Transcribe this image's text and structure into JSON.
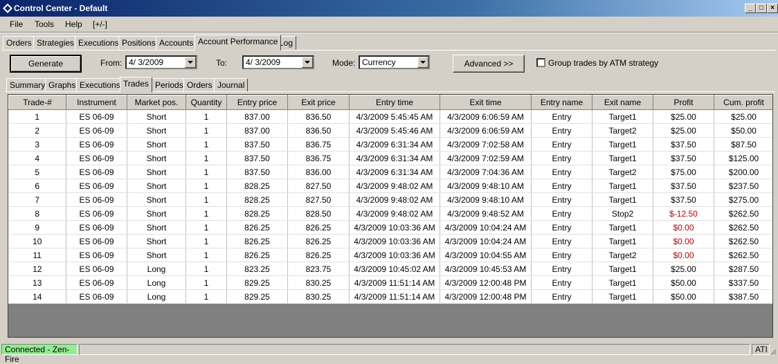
{
  "window": {
    "title": "Control Center - Default"
  },
  "menu": [
    "File",
    "Tools",
    "Help",
    "[+/-]"
  ],
  "main_tabs": [
    "Orders",
    "Strategies",
    "Executions",
    "Positions",
    "Accounts",
    "Account Performance",
    "Log"
  ],
  "toolbar": {
    "generate_label": "Generate",
    "from_label": "From:",
    "from_value": "4/  3/2009",
    "to_label": "To:",
    "to_value": "4/  3/2009",
    "mode_label": "Mode:",
    "mode_value": "Currency",
    "advanced_label": "Advanced >>",
    "group_label": "Group trades by ATM strategy"
  },
  "sub_tabs": [
    "Summary",
    "Graphs",
    "Executions",
    "Trades",
    "Periods",
    "Orders",
    "Journal"
  ],
  "table": {
    "headers": [
      "Trade-#",
      "Instrument",
      "Market pos.",
      "Quantity",
      "Entry price",
      "Exit price",
      "Entry time",
      "Exit time",
      "Entry name",
      "Exit name",
      "Profit",
      "Cum. profit"
    ],
    "rows": [
      [
        "1",
        "ES 06-09",
        "Short",
        "1",
        "837.00",
        "836.50",
        "4/3/2009 5:45:45 AM",
        "4/3/2009 6:06:59 AM",
        "Entry",
        "Target1",
        "$25.00",
        "$25.00"
      ],
      [
        "2",
        "ES 06-09",
        "Short",
        "1",
        "837.00",
        "836.50",
        "4/3/2009 5:45:46 AM",
        "4/3/2009 6:06:59 AM",
        "Entry",
        "Target2",
        "$25.00",
        "$50.00"
      ],
      [
        "3",
        "ES 06-09",
        "Short",
        "1",
        "837.50",
        "836.75",
        "4/3/2009 6:31:34 AM",
        "4/3/2009 7:02:58 AM",
        "Entry",
        "Target1",
        "$37.50",
        "$87.50"
      ],
      [
        "4",
        "ES 06-09",
        "Short",
        "1",
        "837.50",
        "836.75",
        "4/3/2009 6:31:34 AM",
        "4/3/2009 7:02:59 AM",
        "Entry",
        "Target1",
        "$37.50",
        "$125.00"
      ],
      [
        "5",
        "ES 06-09",
        "Short",
        "1",
        "837.50",
        "836.00",
        "4/3/2009 6:31:34 AM",
        "4/3/2009 7:04:36 AM",
        "Entry",
        "Target2",
        "$75.00",
        "$200.00"
      ],
      [
        "6",
        "ES 06-09",
        "Short",
        "1",
        "828.25",
        "827.50",
        "4/3/2009 9:48:02 AM",
        "4/3/2009 9:48:10 AM",
        "Entry",
        "Target1",
        "$37.50",
        "$237.50"
      ],
      [
        "7",
        "ES 06-09",
        "Short",
        "1",
        "828.25",
        "827.50",
        "4/3/2009 9:48:02 AM",
        "4/3/2009 9:48:10 AM",
        "Entry",
        "Target1",
        "$37.50",
        "$275.00"
      ],
      [
        "8",
        "ES 06-09",
        "Short",
        "1",
        "828.25",
        "828.50",
        "4/3/2009 9:48:02 AM",
        "4/3/2009 9:48:52 AM",
        "Entry",
        "Stop2",
        "$-12.50",
        "$262.50"
      ],
      [
        "9",
        "ES 06-09",
        "Short",
        "1",
        "826.25",
        "826.25",
        "4/3/2009 10:03:36 AM",
        "4/3/2009 10:04:24 AM",
        "Entry",
        "Target1",
        "$0.00",
        "$262.50"
      ],
      [
        "10",
        "ES 06-09",
        "Short",
        "1",
        "826.25",
        "826.25",
        "4/3/2009 10:03:36 AM",
        "4/3/2009 10:04:24 AM",
        "Entry",
        "Target1",
        "$0.00",
        "$262.50"
      ],
      [
        "11",
        "ES 06-09",
        "Short",
        "1",
        "826.25",
        "826.25",
        "4/3/2009 10:03:36 AM",
        "4/3/2009 10:04:55 AM",
        "Entry",
        "Target2",
        "$0.00",
        "$262.50"
      ],
      [
        "12",
        "ES 06-09",
        "Long",
        "1",
        "823.25",
        "823.75",
        "4/3/2009 10:45:02 AM",
        "4/3/2009 10:45:53 AM",
        "Entry",
        "Target1",
        "$25.00",
        "$287.50"
      ],
      [
        "13",
        "ES 06-09",
        "Long",
        "1",
        "829.25",
        "830.25",
        "4/3/2009 11:51:14 AM",
        "4/3/2009 12:00:48 PM",
        "Entry",
        "Target1",
        "$50.00",
        "$337.50"
      ],
      [
        "14",
        "ES 06-09",
        "Long",
        "1",
        "829.25",
        "830.25",
        "4/3/2009 11:51:14 AM",
        "4/3/2009 12:00:48 PM",
        "Entry",
        "Target1",
        "$50.00",
        "$387.50"
      ]
    ],
    "red_profit_rows": [
      7,
      8,
      9,
      10
    ]
  },
  "status": {
    "connection": "Connected - Zen-Fire",
    "right": "ATI"
  },
  "colors": {
    "status_connected": "#90ee90",
    "negative": "#c00000"
  }
}
